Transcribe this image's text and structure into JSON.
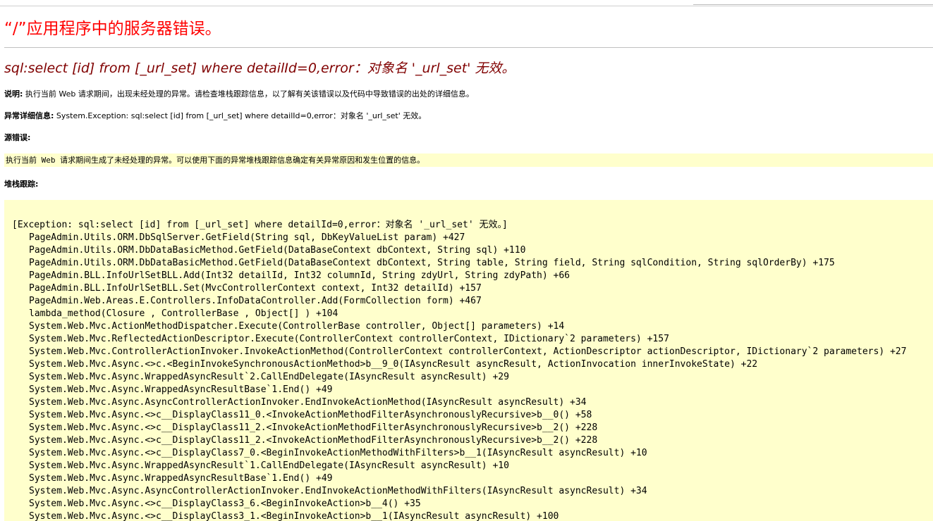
{
  "error_title": "“/”应用程序中的服务器错误。",
  "error_message": "sql:select [id] from [_url_set] where detailId=0,error：对象名 '_url_set' 无效。",
  "description": {
    "label": "说明:",
    "text": " 执行当前 Web 请求期间，出现未经处理的异常。请检查堆栈跟踪信息，以了解有关该错误以及代码中导致错误的出处的详细信息。"
  },
  "exception_details": {
    "label": "异常详细信息:",
    "text": " System.Exception: sql:select [id] from [_url_set] where detailId=0,error：对象名 '_url_set' 无效。"
  },
  "source_error": {
    "label": "源错误:",
    "text": "执行当前 Web 请求期间生成了未经处理的异常。可以使用下面的异常堆栈跟踪信息确定有关异常原因和发生位置的信息。"
  },
  "stack_trace": {
    "label": "堆栈跟踪:",
    "header": "[Exception: sql:select [id] from [_url_set] where detailId=0,error：对象名 '_url_set' 无效。]",
    "lines": [
      "PageAdmin.Utils.ORM.DbSqlServer.GetField(String sql, DbKeyValueList param) +427",
      "PageAdmin.Utils.ORM.DbDataBasicMethod.GetField(DataBaseContext dbContext, String sql) +110",
      "PageAdmin.Utils.ORM.DbDataBasicMethod.GetField(DataBaseContext dbContext, String table, String field, String sqlCondition, String sqlOrderBy) +175",
      "PageAdmin.BLL.InfoUrlSetBLL.Add(Int32 detailId, Int32 columnId, String zdyUrl, String zdyPath) +66",
      "PageAdmin.BLL.InfoUrlSetBLL.Set(MvcControllerContext context, Int32 detailId) +157",
      "PageAdmin.Web.Areas.E.Controllers.InfoDataController.Add(FormCollection form) +467",
      "lambda_method(Closure , ControllerBase , Object[] ) +104",
      "System.Web.Mvc.ActionMethodDispatcher.Execute(ControllerBase controller, Object[] parameters) +14",
      "System.Web.Mvc.ReflectedActionDescriptor.Execute(ControllerContext controllerContext, IDictionary`2 parameters) +157",
      "System.Web.Mvc.ControllerActionInvoker.InvokeActionMethod(ControllerContext controllerContext, ActionDescriptor actionDescriptor, IDictionary`2 parameters) +27",
      "System.Web.Mvc.Async.<>c.<BeginInvokeSynchronousActionMethod>b__9_0(IAsyncResult asyncResult, ActionInvocation innerInvokeState) +22",
      "System.Web.Mvc.Async.WrappedAsyncResult`2.CallEndDelegate(IAsyncResult asyncResult) +29",
      "System.Web.Mvc.Async.WrappedAsyncResultBase`1.End() +49",
      "System.Web.Mvc.Async.AsyncControllerActionInvoker.EndInvokeActionMethod(IAsyncResult asyncResult) +34",
      "System.Web.Mvc.Async.<>c__DisplayClass11_0.<InvokeActionMethodFilterAsynchronouslyRecursive>b__0() +58",
      "System.Web.Mvc.Async.<>c__DisplayClass11_2.<InvokeActionMethodFilterAsynchronouslyRecursive>b__2() +228",
      "System.Web.Mvc.Async.<>c__DisplayClass11_2.<InvokeActionMethodFilterAsynchronouslyRecursive>b__2() +228",
      "System.Web.Mvc.Async.<>c__DisplayClass7_0.<BeginInvokeActionMethodWithFilters>b__1(IAsyncResult asyncResult) +10",
      "System.Web.Mvc.Async.WrappedAsyncResult`1.CallEndDelegate(IAsyncResult asyncResult) +10",
      "System.Web.Mvc.Async.WrappedAsyncResultBase`1.End() +49",
      "System.Web.Mvc.Async.AsyncControllerActionInvoker.EndInvokeActionMethodWithFilters(IAsyncResult asyncResult) +34",
      "System.Web.Mvc.Async.<>c__DisplayClass3_6.<BeginInvokeAction>b__4() +35",
      "System.Web.Mvc.Async.<>c__DisplayClass3_1.<BeginInvokeAction>b__1(IAsyncResult asyncResult) +100"
    ]
  },
  "colors": {
    "title": "#ff0000",
    "message": "#800000",
    "code_background": "#ffffcc"
  }
}
